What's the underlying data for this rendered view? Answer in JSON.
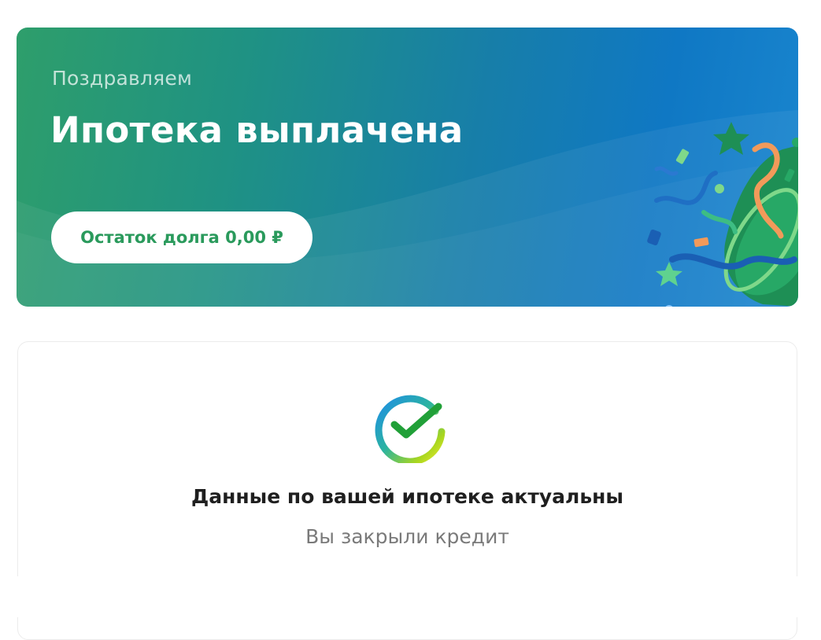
{
  "banner": {
    "greeting": "Поздравляем",
    "headline": "Ипотека выплачена",
    "debt_label": "Остаток долга 0,00 ₽",
    "decoration_icon": "party-popper-confetti-icon"
  },
  "status_card": {
    "icon": "sber-check-logo-icon",
    "title": "Данные по вашей ипотеке актуальны",
    "subtitle": "Вы закрыли кредит"
  },
  "colors": {
    "banner_start": "#2e9e6b",
    "banner_end": "#0f78c4",
    "accent_green": "#2a9a5c",
    "title_text": "#1f1f1f",
    "subtitle_text": "#7a7a7a"
  }
}
